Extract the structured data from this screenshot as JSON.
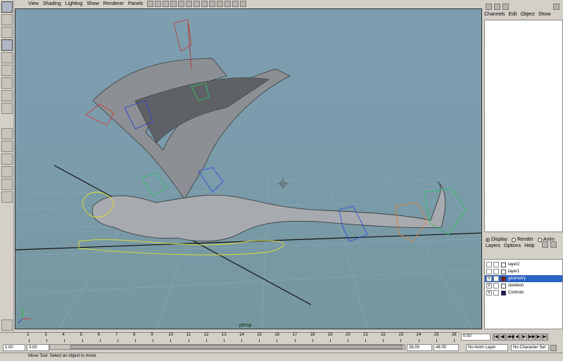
{
  "panel_menu": [
    "View",
    "Shading",
    "Lighting",
    "Show",
    "Renderer",
    "Panels"
  ],
  "viewport": {
    "camera": "persp"
  },
  "channel_box": {
    "menu": [
      "Channels",
      "Edit",
      "Object",
      "Show"
    ]
  },
  "layer_editor": {
    "modes": [
      "Display",
      "Render",
      "Anim"
    ],
    "selected_mode": "Display",
    "menu": [
      "Layers",
      "Options",
      "Help"
    ],
    "layers": [
      {
        "name": "layer2",
        "visible": "",
        "color": "#ffffff",
        "selected": false
      },
      {
        "name": "layer1",
        "visible": "",
        "color": "#ffffff",
        "selected": false
      },
      {
        "name": "geometry",
        "visible": "V",
        "color": "#7a1c1c",
        "selected": true
      },
      {
        "name": "skeleton",
        "visible": "V",
        "color": "#ffffff",
        "selected": false
      },
      {
        "name": "Controls",
        "visible": "V",
        "color": "#2a1060",
        "selected": false
      }
    ]
  },
  "time_slider": {
    "ticks": [
      "2",
      "3",
      "4",
      "5",
      "6",
      "7",
      "8",
      "9",
      "10",
      "11",
      "12",
      "13",
      "14",
      "15",
      "16",
      "17",
      "18",
      "19",
      "20",
      "21",
      "22",
      "23",
      "24",
      "25",
      "26"
    ],
    "current_time": "0.00"
  },
  "range": {
    "start": "1.00",
    "playback_start": "3:00",
    "playback_end": "26.00",
    "end": "48.00",
    "anim_layer": "No Anim Layer",
    "character_set": "No Character Set"
  },
  "help_line": "Move Tool: Select an object to move."
}
